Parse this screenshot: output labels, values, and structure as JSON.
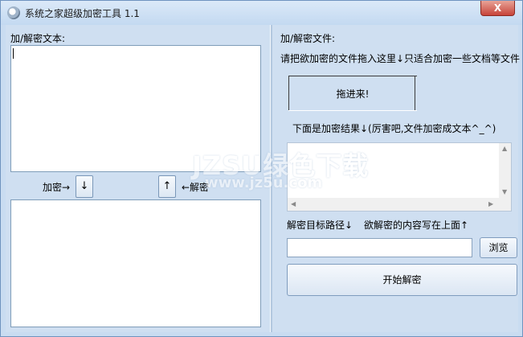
{
  "window": {
    "title": "系统之家超级加密工具 1.1",
    "close_label": "X"
  },
  "left": {
    "text_label": "加/解密文本:",
    "encrypt_label": "加密→",
    "encrypt_arrow": "↓",
    "decrypt_arrow": "↑",
    "decrypt_label": "←解密"
  },
  "right": {
    "file_label": "加/解密文件:",
    "drag_hint": "请把欲加密的文件拖入这里↓只适合加密一些文档等文件",
    "drop_label": "拖进来!",
    "result_label": "下面是加密结果↓(厉害吧,文件加密成文本^_^)",
    "target_path_label": "解密目标路径↓",
    "content_hint": "欲解密的内容写在上面↑",
    "browse_label": "浏览",
    "start_label": "开始解密"
  },
  "watermark": {
    "big": "JZSU绿色下载",
    "small": "www.jz5u.com"
  }
}
